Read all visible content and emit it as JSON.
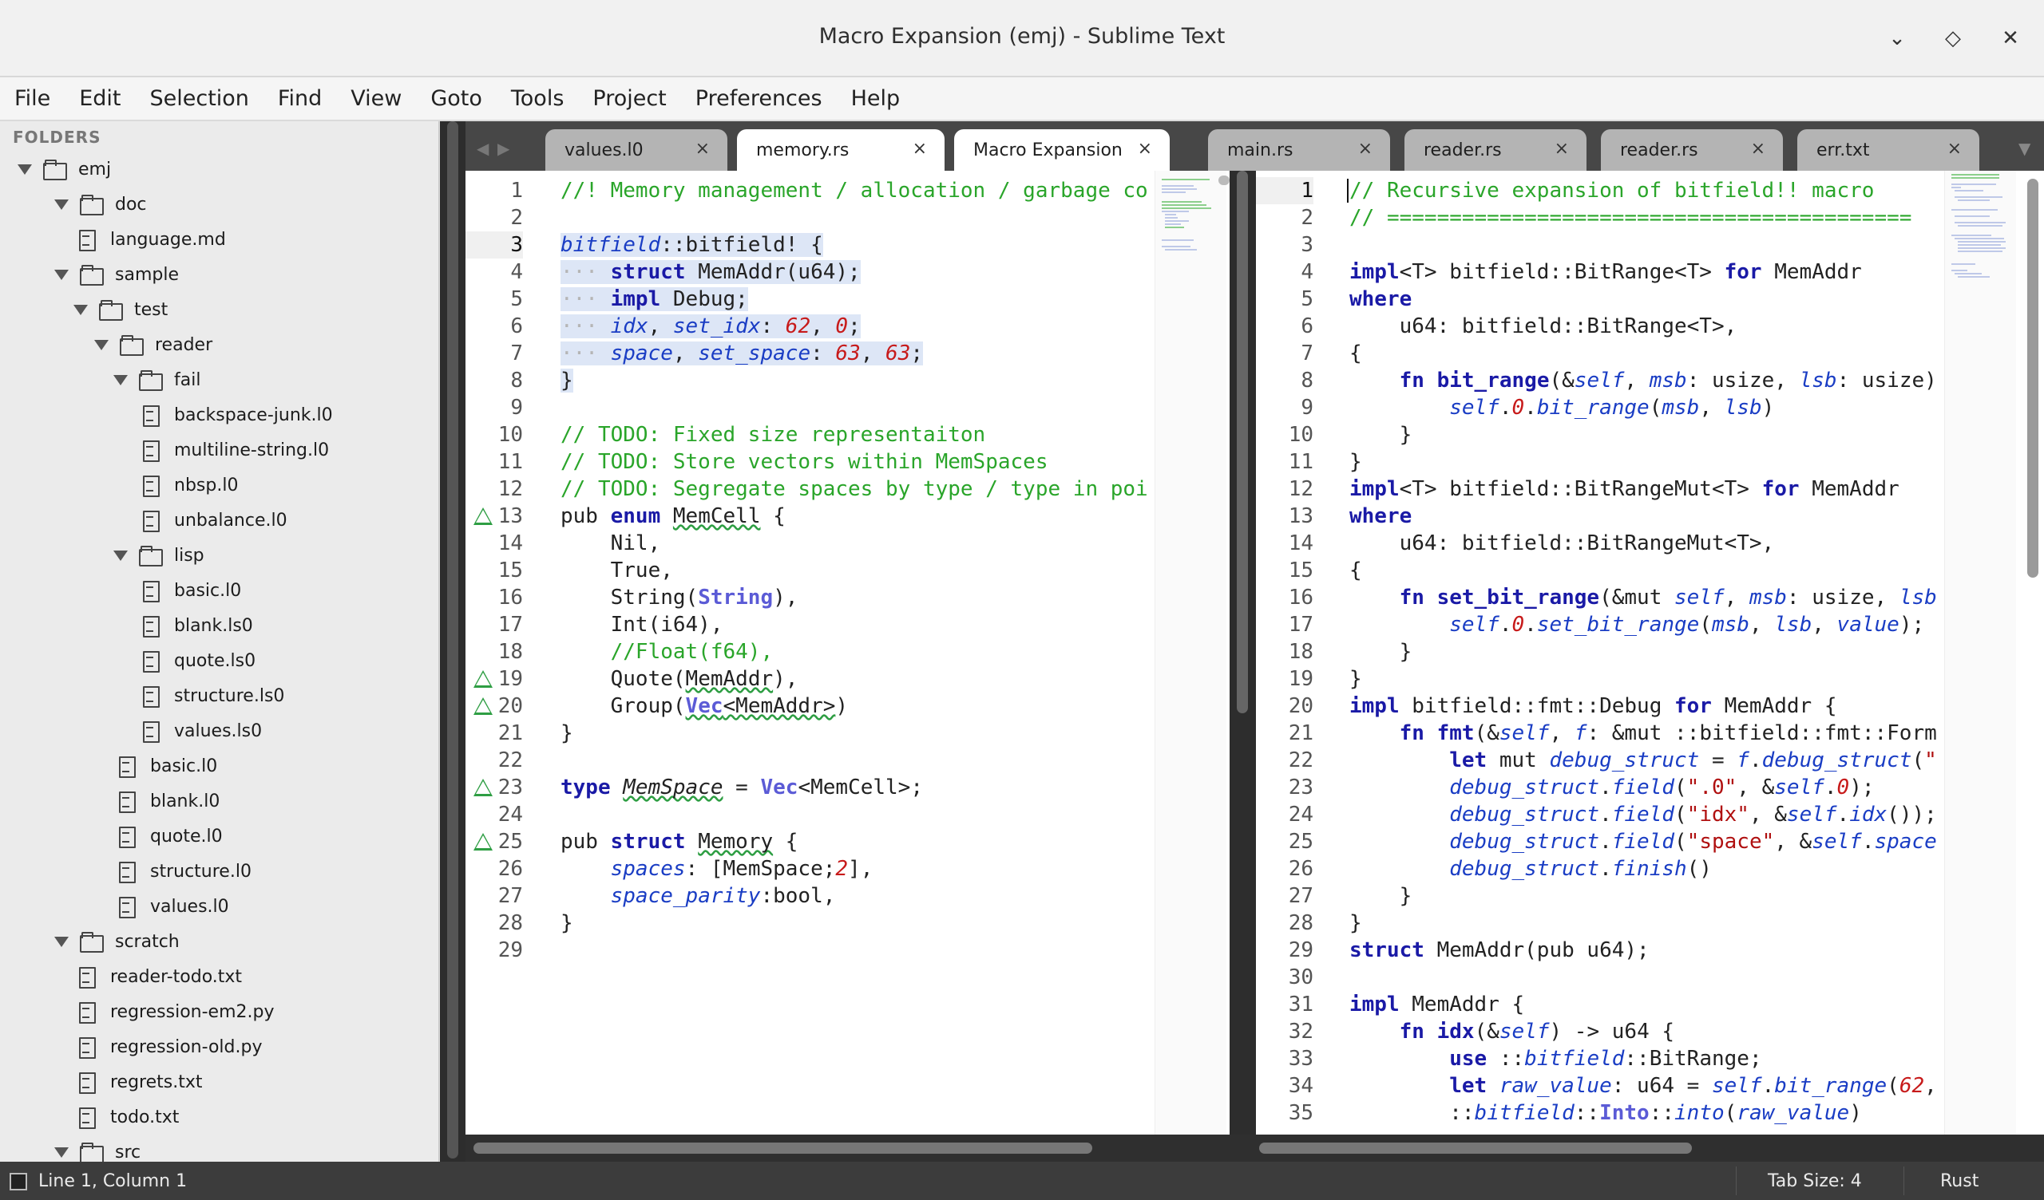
{
  "window": {
    "title": "Macro Expansion (emj) - Sublime Text",
    "controls": [
      "chevron-down",
      "diamond",
      "close"
    ]
  },
  "menu": [
    "File",
    "Edit",
    "Selection",
    "Find",
    "View",
    "Goto",
    "Tools",
    "Project",
    "Preferences",
    "Help"
  ],
  "sidebar": {
    "header": "FOLDERS",
    "tree": [
      {
        "label": "emj",
        "type": "folder",
        "open": true,
        "depth": 0
      },
      {
        "label": "doc",
        "type": "folder",
        "open": true,
        "depth": 1
      },
      {
        "label": "language.md",
        "type": "file",
        "depth": 2
      },
      {
        "label": "sample",
        "type": "folder",
        "open": true,
        "depth": 1
      },
      {
        "label": "test",
        "type": "folder",
        "open": true,
        "depth": 2
      },
      {
        "label": "reader",
        "type": "folder",
        "open": true,
        "depth": 3
      },
      {
        "label": "fail",
        "type": "folder",
        "open": true,
        "depth": 4
      },
      {
        "label": "backspace-junk.l0",
        "type": "file",
        "depth": 5
      },
      {
        "label": "multiline-string.l0",
        "type": "file",
        "depth": 5
      },
      {
        "label": "nbsp.l0",
        "type": "file",
        "depth": 5
      },
      {
        "label": "unbalance.l0",
        "type": "file",
        "depth": 5
      },
      {
        "label": "lisp",
        "type": "folder",
        "open": true,
        "depth": 4
      },
      {
        "label": "basic.l0",
        "type": "file",
        "depth": 5
      },
      {
        "label": "blank.ls0",
        "type": "file",
        "depth": 5
      },
      {
        "label": "quote.ls0",
        "type": "file",
        "depth": 5
      },
      {
        "label": "structure.ls0",
        "type": "file",
        "depth": 5
      },
      {
        "label": "values.ls0",
        "type": "file",
        "depth": 5
      },
      {
        "label": "basic.l0",
        "type": "file",
        "depth": 4
      },
      {
        "label": "blank.l0",
        "type": "file",
        "depth": 4
      },
      {
        "label": "quote.l0",
        "type": "file",
        "depth": 4
      },
      {
        "label": "structure.l0",
        "type": "file",
        "depth": 4
      },
      {
        "label": "values.l0",
        "type": "file",
        "depth": 4
      },
      {
        "label": "scratch",
        "type": "folder",
        "open": true,
        "depth": 1
      },
      {
        "label": "reader-todo.txt",
        "type": "file",
        "depth": 2
      },
      {
        "label": "regression-em2.py",
        "type": "file",
        "depth": 2
      },
      {
        "label": "regression-old.py",
        "type": "file",
        "depth": 2
      },
      {
        "label": "regrets.txt",
        "type": "file",
        "depth": 2
      },
      {
        "label": "todo.txt",
        "type": "file",
        "depth": 2
      },
      {
        "label": "src",
        "type": "folder",
        "open": true,
        "depth": 1
      }
    ]
  },
  "tabs": [
    {
      "label": "values.l0",
      "active": false
    },
    {
      "label": "memory.rs",
      "active": true
    },
    {
      "label": "Macro Expansion",
      "active": true
    },
    {
      "label": "main.rs",
      "active": false
    },
    {
      "label": "reader.rs",
      "active": false
    },
    {
      "label": "reader.rs",
      "active": false
    },
    {
      "label": "err.txt",
      "active": false
    }
  ],
  "tab_close_glyph": "×",
  "left_pane": {
    "file": "memory.rs",
    "current_line": 3,
    "warnings": [
      13,
      19,
      20,
      23,
      25
    ],
    "line_count": 29
  },
  "right_pane": {
    "file": "Macro Expansion",
    "current_line": 1,
    "line_count": 35
  },
  "status": {
    "position": "Line 1, Column 1",
    "tab_size": "Tab Size: 4",
    "syntax": "Rust"
  },
  "colors": {
    "comment": "#2aa52a",
    "keyword": "#1a1aa6",
    "type": "#5b5bd6",
    "number": "#c71a1a",
    "selection": "#dde6f6",
    "warning": "#2e9e43"
  }
}
